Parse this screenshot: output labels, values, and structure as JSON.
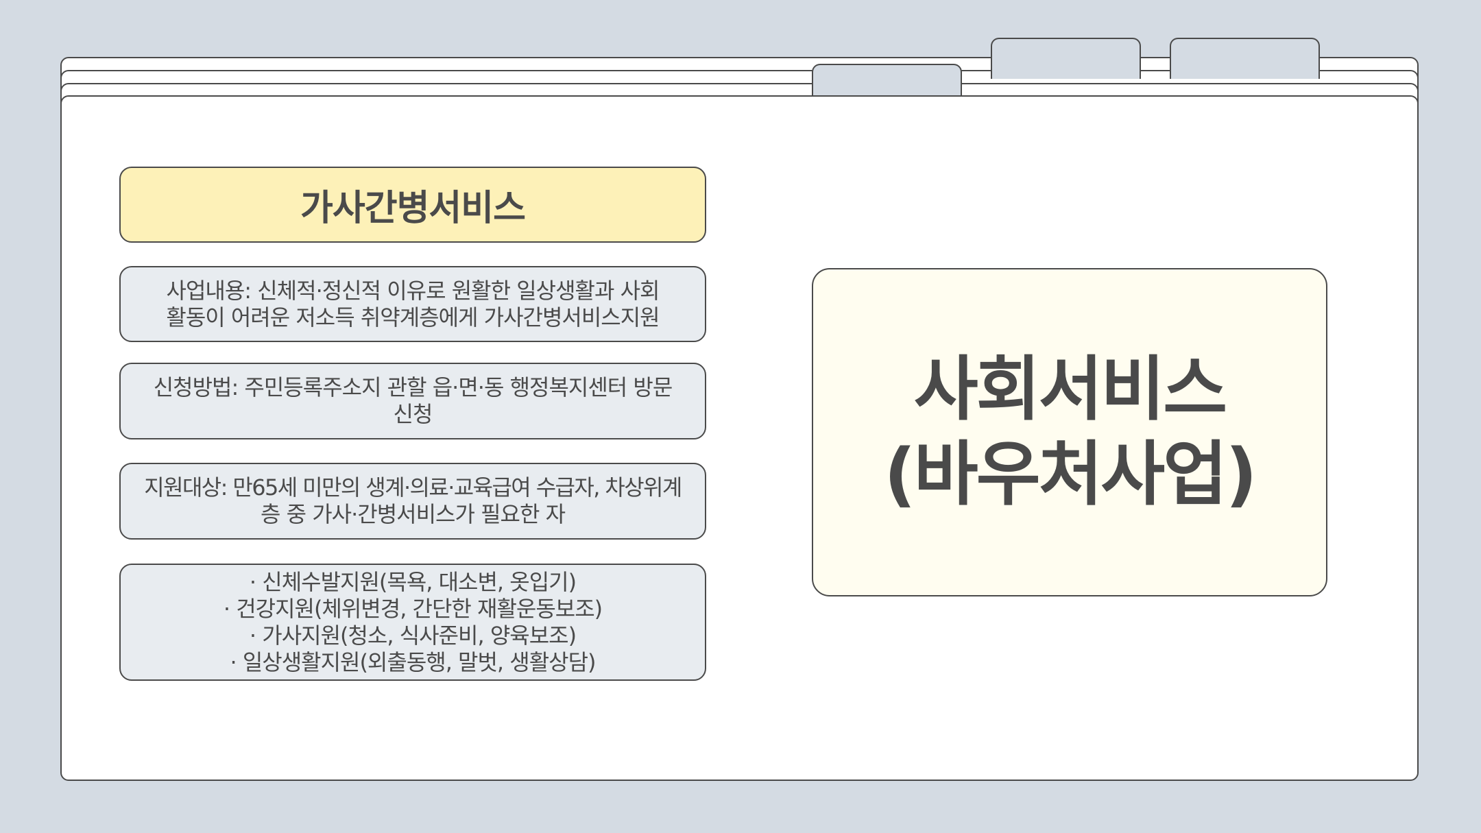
{
  "service_card": {
    "title": "가사간병서비스",
    "business_content": [
      "사업내용: 신체적·정신적 이유로 원활한 일상생활과 사회",
      "활동이 어려운 저소득 취약계층에게 가사간병서비스지원"
    ],
    "application_method": [
      "신청방법: 주민등록주소지 관할 읍·면·동 행정복지센터 방문",
      "신청"
    ],
    "eligibility": [
      "지원대상: 만65세 미만의 생계·의료·교육급여 수급자, 차상위계",
      "층 중 가사·간병서비스가 필요한 자"
    ],
    "services": [
      "· 신체수발지원(목욕, 대소변, 옷입기)",
      "· 건강지원(체위변경, 간단한 재활운동보조)",
      "· 가사지원(청소, 식사준비, 양육보조)",
      "· 일상생활지원(외출동행, 말벗, 생활상담)"
    ]
  },
  "main_title": {
    "line1": "사회서비스",
    "line2": "(바우처사업)"
  },
  "colors": {
    "background": "#d4dbe3",
    "folder": "#ffffff",
    "title_box": "#fdf1b8",
    "info_box": "#e8ecf0",
    "main_box": "#fffdf0",
    "outline": "#4a4a4a"
  }
}
